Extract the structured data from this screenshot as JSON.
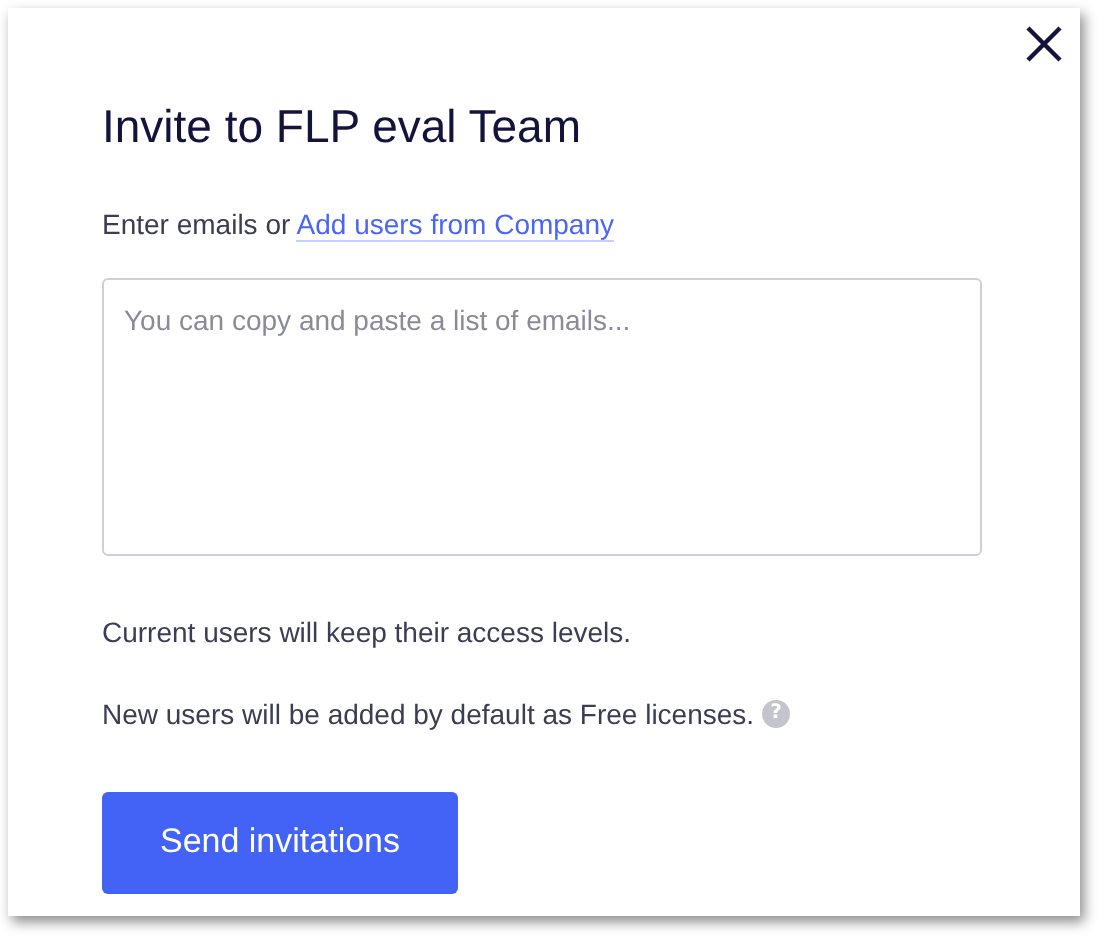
{
  "dialog": {
    "title": "Invite to FLP eval Team",
    "intro": {
      "text": "Enter emails or ",
      "link": "Add users from Company"
    },
    "emails_field": {
      "placeholder": "You can copy and paste a list of emails..."
    },
    "notes": [
      {
        "text": "Current users will keep their access levels."
      },
      {
        "text": "New users will be added by default as Free licenses.",
        "help": "?"
      }
    ],
    "button": "Send invitations"
  }
}
